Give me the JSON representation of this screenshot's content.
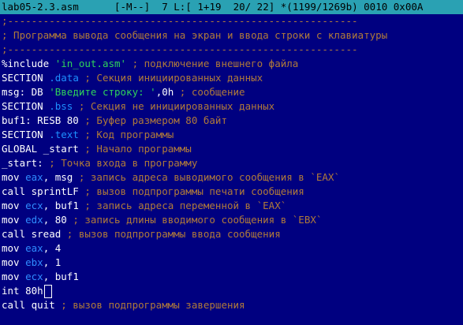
{
  "status_bar": {
    "filename": "lab05-2.3.asm",
    "mode": "[-M--]",
    "col": "7",
    "line_label": "L:[",
    "line_pos": "1+19",
    "line_count": "20/ 22]",
    "char_info": "*(1199/1269b)",
    "char_code": "0010 0x00A"
  },
  "code": {
    "rule1": ";-----------------------------------------------------------",
    "header": "; Программа вывода сообщения на экран и ввода строки с клавиатуры",
    "rule2": ";-----------------------------------------------------------",
    "l_include_kw": "%include ",
    "l_include_file": "'in_out.asm'",
    "l_include_cmt": " ; подключение внешнего файла",
    "l_sd_kw": "SECTION ",
    "l_sd_name": ".data",
    "l_sd_cmt": " ; Секция инициированных данных",
    "l_msg_kw": "msg: DB ",
    "l_msg_str": "'Введите строку: '",
    "l_msg_rest": ",0h",
    "l_msg_cmt": " ; сообщение",
    "l_sb_kw": "SECTION ",
    "l_sb_name": ".bss",
    "l_sb_cmt": " ; Секция не инициированных данных",
    "l_buf_kw": "buf1: RESB 80",
    "l_buf_cmt": " ; Буфер размером 80 байт",
    "l_st_kw": "SECTION ",
    "l_st_name": ".text",
    "l_st_cmt": " ; Код программы",
    "l_gl_kw": "GLOBAL _start",
    "l_gl_cmt": " ; Начало программы",
    "l_start_kw": "_start:",
    "l_start_cmt": " ; Точка входа в программу",
    "l_m1_kw": "mov ",
    "l_m1_reg": "eax",
    "l_m1_rest": ", msg",
    "l_m1_cmt": " ; запись адреса выводимого сообщения в `EAX`",
    "l_c1_kw": "call sprintLF",
    "l_c1_cmt": " ; вызов подпрограммы печати сообщения",
    "l_m2_kw": "mov ",
    "l_m2_reg": "ecx",
    "l_m2_rest": ", buf1",
    "l_m2_cmt": " ; запись адреса переменной в `EAX`",
    "l_m3_kw": "mov ",
    "l_m3_reg": "edx",
    "l_m3_rest": ", 80",
    "l_m3_cmt": " ; запись длины вводимого сообщения в `EBX`",
    "l_c2_kw": "call sread",
    "l_c2_cmt": " ; вызов подпрограммы ввода сообщения",
    "l_m4_kw": "mov ",
    "l_m4_reg": "eax",
    "l_m4_rest": ", 4",
    "l_m5_kw": "mov ",
    "l_m5_reg": "ebx",
    "l_m5_rest": ", 1",
    "l_m6_kw": "mov ",
    "l_m6_reg": "ecx",
    "l_m6_rest": ", buf1",
    "l_int_kw": "int 80h",
    "l_c3_kw": "call quit",
    "l_c3_cmt": " ; вызов подпрограммы завершения"
  },
  "colors": {
    "background": "#000080",
    "status_bg": "#2aa1b3",
    "comment": "#b07a3a",
    "section_name": "#1e90ff",
    "string": "#2fd35a",
    "register": "#2f8cff"
  }
}
